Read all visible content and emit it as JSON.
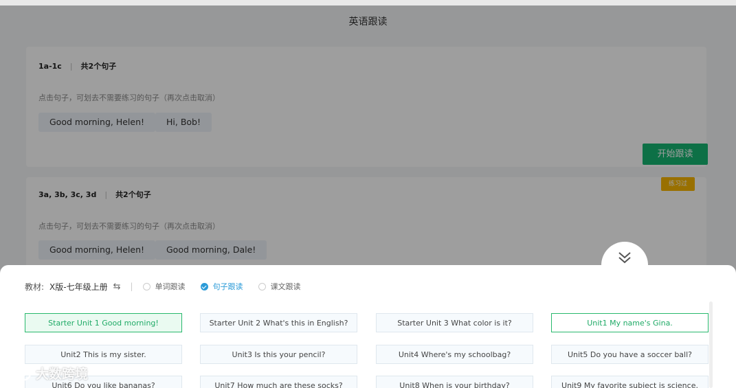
{
  "page": {
    "title": "英语跟读"
  },
  "sections": [
    {
      "id": "1a-1c",
      "count_text": "共2个句子",
      "hint": "点击句子，可划去不需要练习的句子（再次点击取消）",
      "sentences": [
        "Good morning, Helen!",
        "Hi, Bob!"
      ]
    },
    {
      "id": "3a, 3b, 3c, 3d",
      "count_text": "共2个句子",
      "hint": "点击句子，可划去不需要练习的句子（再次点击取消）",
      "sentences": [
        "Good morning, Helen!",
        "Good morning, Dale!"
      ]
    }
  ],
  "start_button": {
    "label": "开始跟读",
    "color": "#16b571"
  },
  "tag": {
    "label": "练习过",
    "color": "#f7b500"
  },
  "panel": {
    "textbook_label": "教材:",
    "textbook_value": "X版-七年级上册",
    "swap_icon": "⇆",
    "modes": [
      {
        "label": "单词跟读",
        "active": false
      },
      {
        "label": "句子跟读",
        "active": true
      },
      {
        "label": "课文跟读",
        "active": false
      }
    ],
    "units": [
      {
        "label": "Starter Unit 1 Good morning!",
        "state": "active"
      },
      {
        "label": "Starter Unit 2 What's this in English?",
        "state": "normal"
      },
      {
        "label": "Starter Unit 3 What color is it?",
        "state": "normal"
      },
      {
        "label": "Unit1 My name's Gina.",
        "state": "outlined"
      },
      {
        "label": "Unit2 This is my sister.",
        "state": "normal"
      },
      {
        "label": "Unit3 Is this your pencil?",
        "state": "normal"
      },
      {
        "label": "Unit4 Where's my schoolbag?",
        "state": "normal"
      },
      {
        "label": "Unit5 Do you have a soccer ball?",
        "state": "normal"
      },
      {
        "label": "Unit6 Do you like bananas?",
        "state": "normal"
      },
      {
        "label": "Unit7 How much are these socks?",
        "state": "normal"
      },
      {
        "label": "Unit8 When is your birthday?",
        "state": "normal"
      },
      {
        "label": "Unit9 My favorite subject is science.",
        "state": "normal"
      }
    ],
    "accent_color": "#27b86c",
    "mode_active_color": "#2b9bd8"
  },
  "watermark": {
    "text": "大数跨境"
  }
}
